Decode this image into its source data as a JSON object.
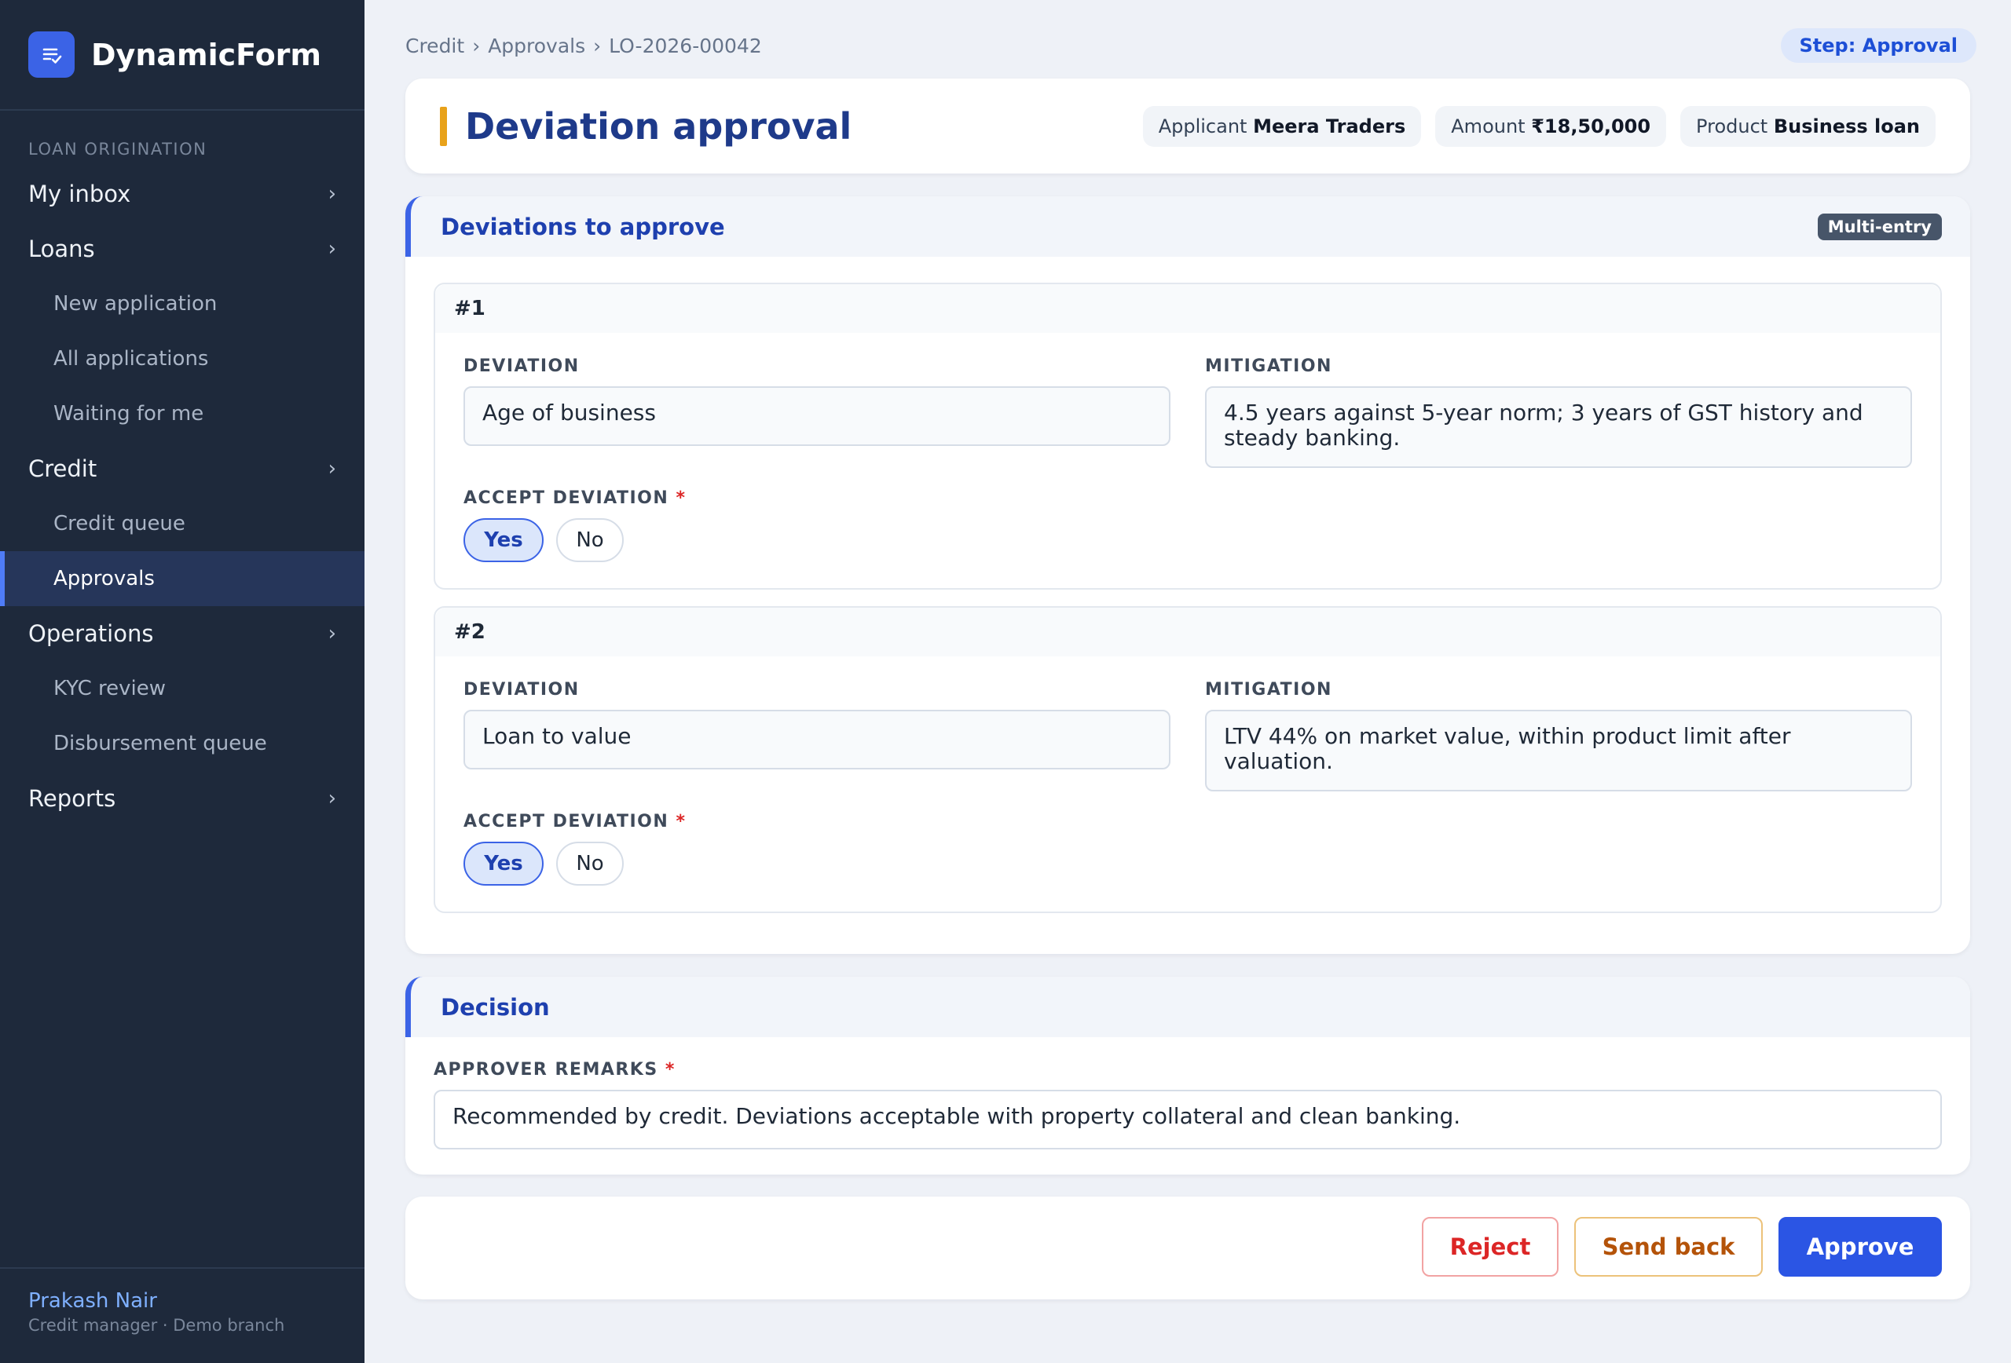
{
  "app": {
    "name": "DynamicForm"
  },
  "sidebar": {
    "section_label": "LOAN ORIGINATION",
    "items": [
      {
        "label": "My inbox",
        "type": "group"
      },
      {
        "label": "Loans",
        "type": "group"
      },
      {
        "label": "New application",
        "type": "sub"
      },
      {
        "label": "All applications",
        "type": "sub"
      },
      {
        "label": "Waiting for me",
        "type": "sub"
      },
      {
        "label": "Credit",
        "type": "group"
      },
      {
        "label": "Credit queue",
        "type": "sub"
      },
      {
        "label": "Approvals",
        "type": "sub",
        "active": true
      },
      {
        "label": "Operations",
        "type": "group"
      },
      {
        "label": "KYC review",
        "type": "sub"
      },
      {
        "label": "Disbursement queue",
        "type": "sub"
      },
      {
        "label": "Reports",
        "type": "group"
      }
    ],
    "chevron": "›",
    "user": {
      "name": "Prakash Nair",
      "role": "Credit manager · Demo branch"
    }
  },
  "breadcrumb": [
    "Credit",
    "Approvals",
    "LO-2026-00042"
  ],
  "breadcrumb_sep": "›",
  "step_badge": "Step: Approval",
  "header": {
    "title": "Deviation approval",
    "chips": [
      {
        "label": "Applicant",
        "value": "Meera Traders"
      },
      {
        "label": "Amount",
        "value": "₹18,50,000"
      },
      {
        "label": "Product",
        "value": "Business loan"
      }
    ]
  },
  "deviations": {
    "title": "Deviations to approve",
    "badge": "Multi-entry",
    "deviation_label": "DEVIATION",
    "mitigation_label": "MITIGATION",
    "accept_label": "ACCEPT DEVIATION",
    "required_mark": "*",
    "yes_label": "Yes",
    "no_label": "No",
    "entries": [
      {
        "index": "#1",
        "deviation": "Age of business",
        "mitigation": "4.5 years against 5-year norm; 3 years of GST history and steady banking.",
        "accepted": "Yes"
      },
      {
        "index": "#2",
        "deviation": "Loan to value",
        "mitigation": "LTV 44% on market value, within product limit after valuation.",
        "accepted": "Yes"
      }
    ]
  },
  "decision": {
    "title": "Decision",
    "remarks_label": "APPROVER REMARKS",
    "remarks_value": "Recommended by credit. Deviations acceptable with property collateral and clean banking."
  },
  "actions": {
    "reject": "Reject",
    "send_back": "Send back",
    "approve": "Approve"
  },
  "colors": {
    "accent": "#2b55e4",
    "sidebar": "#1e293b",
    "title": "#1e3a8a",
    "reject": "#dc2626",
    "send_back": "#b45309"
  },
  "icons": {
    "brand": "form-check-icon"
  }
}
